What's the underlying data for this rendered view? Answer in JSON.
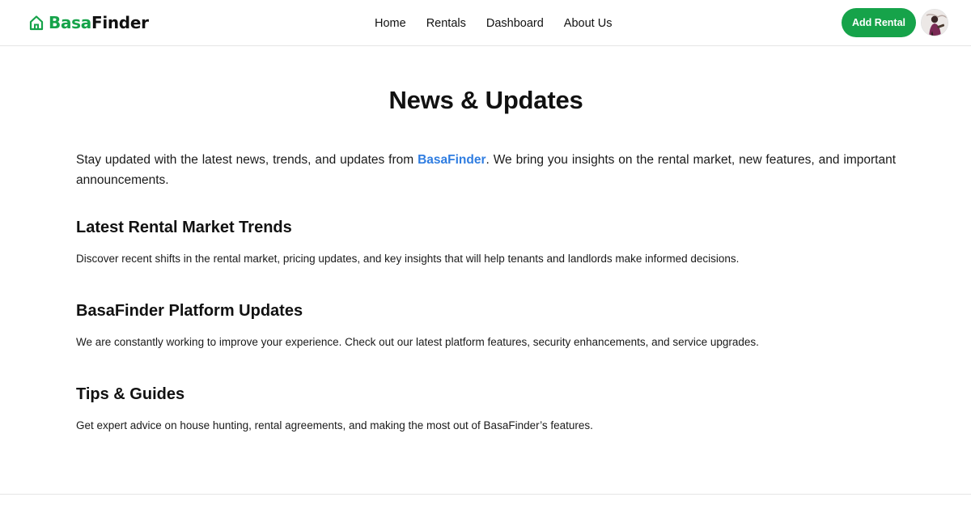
{
  "header": {
    "logo": {
      "part1": "Basa",
      "part2": "Finder",
      "icon": "house-icon"
    },
    "nav": [
      {
        "label": "Home"
      },
      {
        "label": "Rentals"
      },
      {
        "label": "Dashboard"
      },
      {
        "label": "About Us"
      }
    ],
    "add_rental_label": "Add Rental",
    "avatar_icon": "user-avatar"
  },
  "main": {
    "title": "News & Updates",
    "intro": {
      "before": "Stay updated with the latest news, trends, and updates from ",
      "brand": "BasaFinder",
      "after": ". We bring you insights on the rental market, new features, and important announcements."
    },
    "sections": [
      {
        "heading": "Latest Rental Market Trends",
        "text": "Discover recent shifts in the rental market, pricing updates, and key insights that will help tenants and landlords make informed decisions."
      },
      {
        "heading": "BasaFinder Platform Updates",
        "text": "We are constantly working to improve your experience. Check out our latest platform features, security enhancements, and service upgrades."
      },
      {
        "heading": "Tips & Guides",
        "text": "Get expert advice on house hunting, rental agreements, and making the most out of BasaFinder’s features."
      }
    ]
  },
  "colors": {
    "brand_green": "#16a34a",
    "link_blue": "#2f7de1",
    "text": "#111111"
  }
}
